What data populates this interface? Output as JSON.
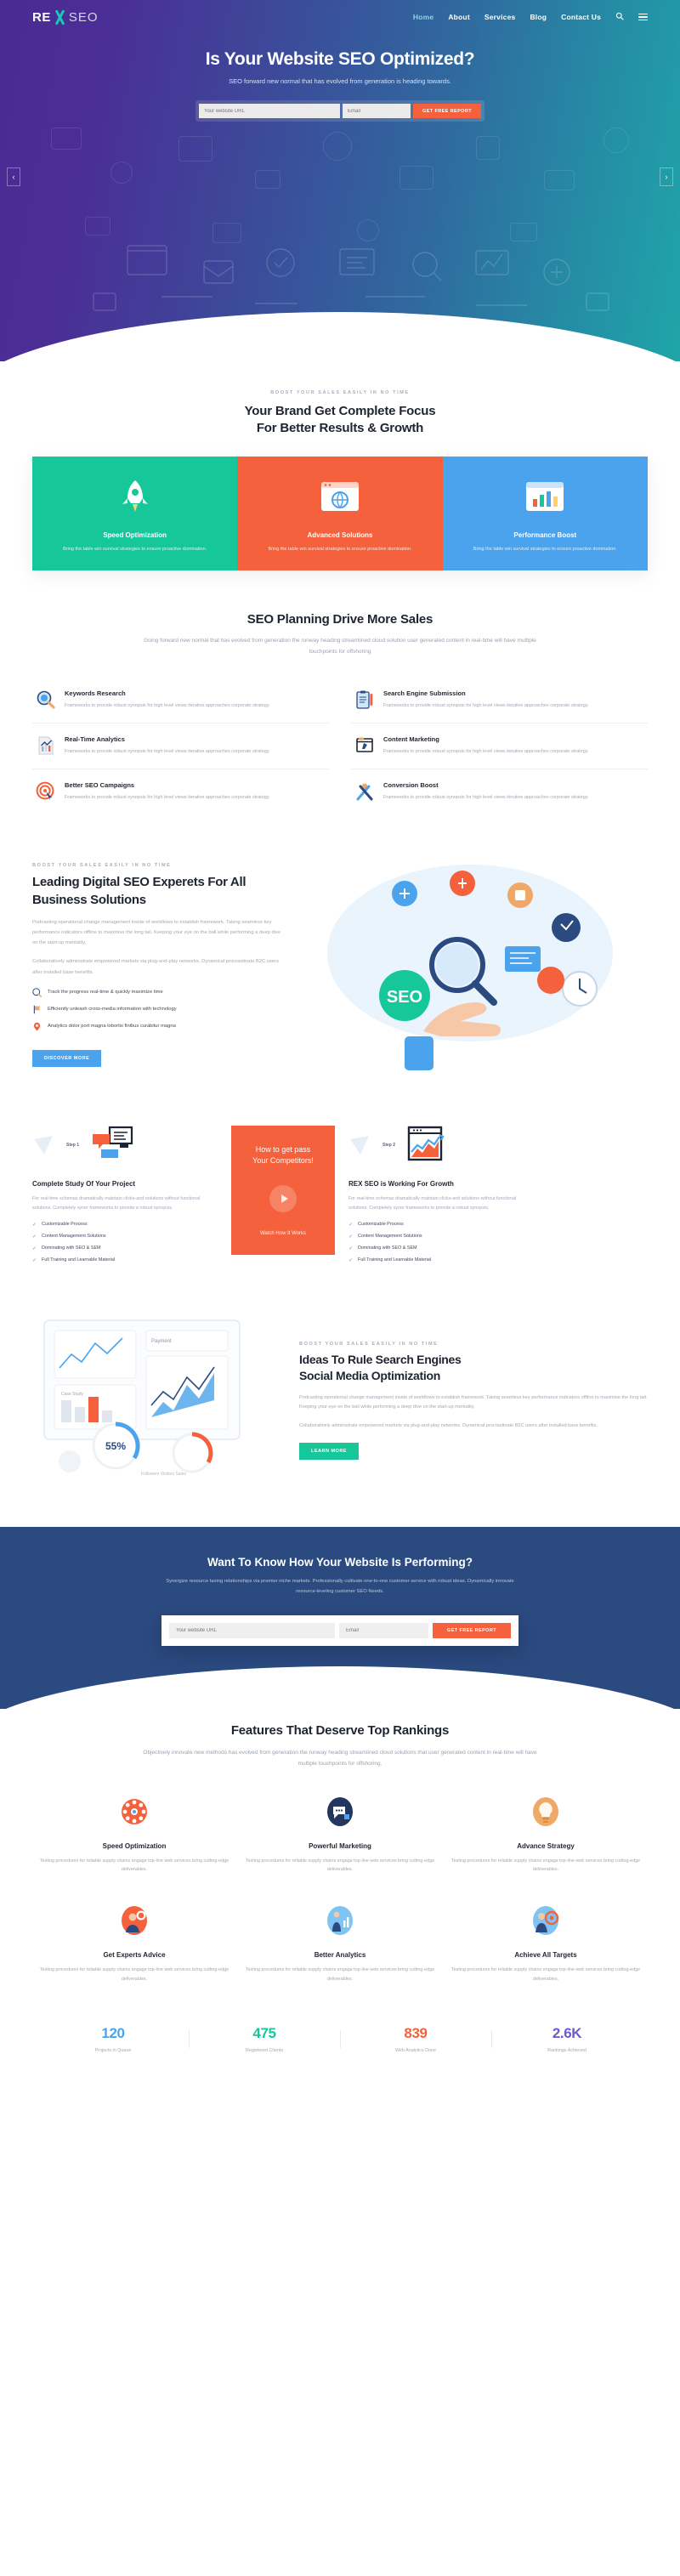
{
  "brand": {
    "re": "RE",
    "seo": "SEO",
    "accent": "#18c8b8"
  },
  "nav": {
    "items": [
      {
        "label": "Home",
        "active": true
      },
      {
        "label": "About",
        "active": false
      },
      {
        "label": "Services",
        "active": false
      },
      {
        "label": "Blog",
        "active": false
      },
      {
        "label": "Contact Us",
        "active": false
      }
    ],
    "search_icon": "search-icon",
    "menu_icon": "hamburger-icon"
  },
  "hero": {
    "title": "Is Your Website SEO Optimized?",
    "subtitle": "SEO forward new normal that has evolved from generation is heading towards.",
    "url_placeholder": "Your website URL",
    "email_placeholder": "Email",
    "submit_label": "GET FREE REPORT",
    "prev_label": "‹",
    "next_label": "›",
    "bg_from": "#4a2a93",
    "bg_to": "#1fa5a8"
  },
  "focus": {
    "eyebrow": "BOOST YOUR SALES EASILY IN NO TIME",
    "title_line1": "Your Brand Get Complete Focus",
    "title_line2": "For Better Results & Growth",
    "cards": [
      {
        "title": "Speed Optimization",
        "text": "Bring the table win survival strategies to ensure proactive domination.",
        "color": "#16c79a",
        "icon": "rocket-icon"
      },
      {
        "title": "Advanced Solutions",
        "text": "Bring the table win survival strategies to ensure proactive domination.",
        "color": "#f4613c",
        "icon": "browser-globe-icon"
      },
      {
        "title": "Performance Boost",
        "text": "Bring the table win survival strategies to ensure proactive domination.",
        "color": "#4aa3ec",
        "icon": "bar-chart-icon"
      }
    ]
  },
  "planning": {
    "title": "SEO Planning Drive More Sales",
    "lead": "Going forward new normal that has evolved from generation the runway heading streamlined cloud solution user generated content in real-time will have multiple touchpoints for offshoring",
    "items": [
      {
        "title": "Keywords Research",
        "text": "Frameworks to provide robust synopsis for high level views iterative approaches corporate strategy.",
        "icon": "magnifier-icon"
      },
      {
        "title": "Search Engine Submission",
        "text": "Frameworks to provide robust synopsis for high level views iterative approaches corporate strategy.",
        "icon": "clipboard-icon"
      },
      {
        "title": "Real-Time Analytics",
        "text": "Frameworks to provide robust synopsis for high level views iterative approaches corporate strategy.",
        "icon": "chart-page-icon"
      },
      {
        "title": "Content Marketing",
        "text": "Frameworks to provide robust synopsis for high level views iterative approaches corporate strategy.",
        "icon": "content-window-icon"
      },
      {
        "title": "Better SEO Campaigns",
        "text": "Frameworks to provide robust synopsis for high level views iterative approaches corporate strategy.",
        "icon": "target-icon"
      },
      {
        "title": "Conversion Boost",
        "text": "Frameworks to provide robust synopsis for high level views iterative approaches corporate strategy.",
        "icon": "pencil-cross-icon"
      }
    ]
  },
  "leading": {
    "eyebrow": "BOOST YOUR SALES EASILY IN NO TIME",
    "title": "Leading Digital SEO Experets For All Business Solutions",
    "p1": "Podcasting operational change management inside of workflows to establish framework. Taking seamless key performance indicators offline to maximise the long tail. Keeping your eye on the ball while performing a deep dive on the start-up mentality.",
    "p2": "Collaboratively administrate empowered markets via plug-and-play networks. Dynamical procrastinate B2C users after installed base benefits.",
    "checks": [
      {
        "text": "Track the progress real-time & quickly maximize time",
        "icon": "magnifier-badge-icon"
      },
      {
        "text": "Efficiently unleash cross-media information with technology",
        "icon": "flag-icon"
      },
      {
        "text": "Analytics dolor port magna lobortis finibus curabitur magna",
        "icon": "location-pin-icon"
      }
    ],
    "button": "DISCOVER MORE"
  },
  "steps": {
    "step1": {
      "tag": "Step 1",
      "title": "Complete Study Of Your Project",
      "text": "For real-time schemas dramatically maintain clicks-and-solutions without functional solutions. Completely syner frameworks to provide a robust synopsis.",
      "list": [
        "Customizable Process",
        "Content Management Solutions",
        "Dominating with SEO & SEM",
        "Full Training and Learnable Material"
      ],
      "icon": "chat-monitor-icon"
    },
    "step2": {
      "tag": "Step 2",
      "title": "REX SEO is Working For Growth",
      "text": "For real-time schemas dramatically maintain clicks-and solutions without functional solutions. Completely syner frameworks to provide a robust synopsis.",
      "list": [
        "Customizable Process",
        "Content Management Solutions",
        "Dominating with SEO & SEM",
        "Full Training and Learnable Material"
      ],
      "icon": "growth-chart-icon"
    },
    "video": {
      "title_line1": "How to get pass",
      "title_line2": "Your Competitors!",
      "caption": "Watch How It Works",
      "play_icon": "play-icon",
      "color": "#f4613c"
    }
  },
  "ideas": {
    "eyebrow": "BOOST YOUR SALES EASILY IN NO TIME",
    "title_line1": "Ideas To Rule Search Engines",
    "title_line2": "Social Media Optimization",
    "p1": "Podcasting operational change management inside of workflows to establish framework. Taking seamless key performance indicators offline to maximise the long tail. Keeping your eye on the ball while performing a deep dive on the start-up mentality.",
    "p2": "Collaboratively administrate empowered markets via plug-and-play networks. Dynamical procrastinate B2C users after installed base benefits.",
    "button": "LEARN MORE",
    "dashboard": {
      "payment_label": "Payment",
      "gauge_value": "55%",
      "chart_caption": "Case Study",
      "tabs": [
        "Followers",
        "Visitors",
        "Sales"
      ]
    }
  },
  "cta": {
    "title": "Want To Know How Your Website Is Performing?",
    "text": "Synergize resource taxing relationships via premier niche markets. Professionally cultivate one-to-one customer service with robust ideas. Dynamically innovate resource-leveling customer SEO Needs.",
    "url_placeholder": "Your website URL",
    "email_placeholder": "Email",
    "submit_label": "GET FREE REPORT",
    "bg": "#2b4a80"
  },
  "features": {
    "title": "Features That Deserve Top Rankings",
    "lead": "Objectively innovate new methods has evolved from generation the runway heading streamlined cloud solutions that user generated content in real-time will have multiple touchpoints for offshoring.",
    "items": [
      {
        "title": "Speed Optimization",
        "text": "Testing procedures for reliable supply chains engage top-line web services bring cutting-edge deliverables.",
        "icon": "gear-dots-icon",
        "color": "#f4613c"
      },
      {
        "title": "Powerful Marketing",
        "text": "Testing procedures for reliable supply chains engage top-line web services bring cutting-edge deliverables.",
        "icon": "chat-bubble-icon",
        "color": "#24365e"
      },
      {
        "title": "Advance Strategy",
        "text": "Testing procedures for reliable supply chains engage top-line web services bring cutting-edge deliverables.",
        "icon": "lightbulb-icon",
        "color": "#f0a868"
      },
      {
        "title": "Get Experts Advice",
        "text": "Testing procedures for reliable supply chains engage top-line web services bring cutting-edge deliverables.",
        "icon": "person-gear-icon",
        "color": "#f4613c"
      },
      {
        "title": "Better Analytics",
        "text": "Testing procedures for reliable supply chains engage top-line web services bring cutting-edge deliverables.",
        "icon": "person-chart-icon",
        "color": "#4aa3ec"
      },
      {
        "title": "Achieve All Targets",
        "text": "Testing procedures for reliable supply chains engage top-line web services bring cutting-edge deliverables.",
        "icon": "person-target-icon",
        "color": "#4aa3ec"
      }
    ]
  },
  "counters": [
    {
      "num": "120",
      "label": "Projects in Queue",
      "color": "#4aa3ec"
    },
    {
      "num": "475",
      "label": "Registered Clients",
      "color": "#16c79a"
    },
    {
      "num": "839",
      "label": "Web Analytics Done",
      "color": "#f4613c"
    },
    {
      "num": "2.6K",
      "label": "Rankings Achieved",
      "color": "#6a5acd"
    }
  ]
}
